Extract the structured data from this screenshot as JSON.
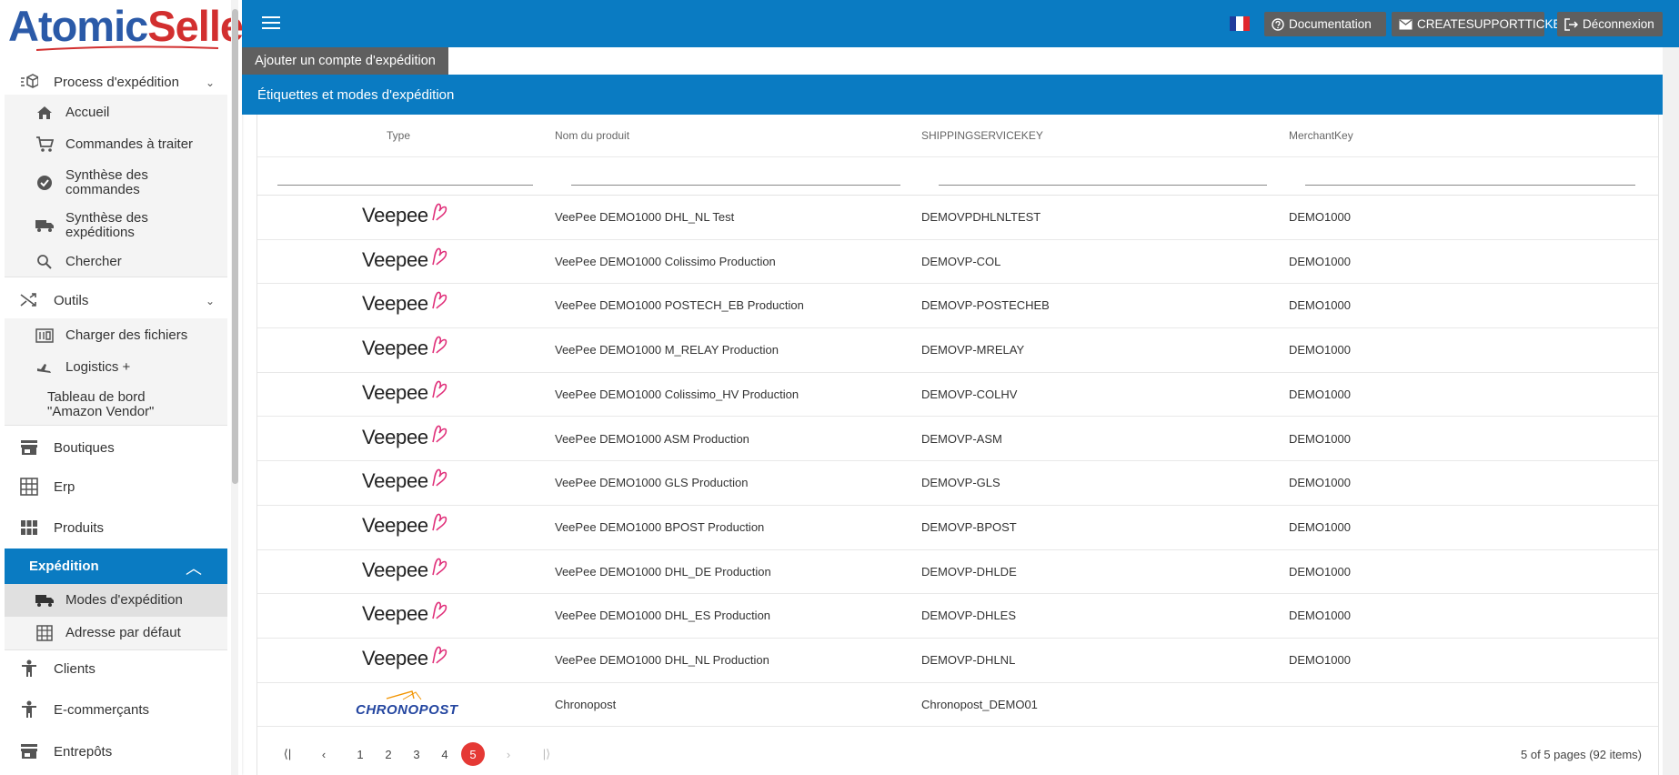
{
  "brand": {
    "part1": "Atomic",
    "part2": "Seller"
  },
  "sidebar": {
    "process": {
      "label": "Process d'expédition"
    },
    "process_items": [
      {
        "label": "Accueil"
      },
      {
        "label": "Commandes à traiter"
      },
      {
        "label": "Synthèse des commandes"
      },
      {
        "label": "Synthèse des expéditions"
      },
      {
        "label": "Chercher"
      }
    ],
    "outils": {
      "label": "Outils"
    },
    "outils_items": [
      {
        "label": "Charger des fichiers"
      },
      {
        "label": "Logistics +"
      },
      {
        "label": "Tableau de bord \"Amazon Vendor\""
      }
    ],
    "boutiques": {
      "label": "Boutiques"
    },
    "erp": {
      "label": "Erp"
    },
    "produits": {
      "label": "Produits"
    },
    "expedition": {
      "label": "Expédition"
    },
    "expedition_items": [
      {
        "label": "Modes d'expédition"
      },
      {
        "label": "Adresse par défaut"
      }
    ],
    "clients": {
      "label": "Clients"
    },
    "ecommercants": {
      "label": "E-commerçants"
    },
    "entrepots": {
      "label": "Entrepôts"
    }
  },
  "topbar": {
    "documentation": "Documentation",
    "support": "CREATESUPPORTTICKET",
    "logout": "Déconnexion"
  },
  "add_account_button": "Ajouter un compte d'expédition",
  "panel_title": "Étiquettes et modes d'expédition",
  "grid": {
    "columns": [
      "Type",
      "Nom du produit",
      "SHIPPINGSERVICEKEY",
      "MerchantKey"
    ],
    "rows": [
      {
        "type": "Veepee",
        "product": "VeePee DEMO1000 DHL_NL Test",
        "key": "DEMOVPDHLNLTEST",
        "merchant": "DEMO1000"
      },
      {
        "type": "Veepee",
        "product": "VeePee DEMO1000 Colissimo Production",
        "key": "DEMOVP-COL",
        "merchant": "DEMO1000"
      },
      {
        "type": "Veepee",
        "product": "VeePee DEMO1000 POSTECH_EB Production",
        "key": "DEMOVP-POSTECHEB",
        "merchant": "DEMO1000"
      },
      {
        "type": "Veepee",
        "product": "VeePee DEMO1000 M_RELAY Production",
        "key": "DEMOVP-MRELAY",
        "merchant": "DEMO1000"
      },
      {
        "type": "Veepee",
        "product": "VeePee DEMO1000 Colissimo_HV Production",
        "key": "DEMOVP-COLHV",
        "merchant": "DEMO1000"
      },
      {
        "type": "Veepee",
        "product": "VeePee DEMO1000 ASM Production",
        "key": "DEMOVP-ASM",
        "merchant": "DEMO1000"
      },
      {
        "type": "Veepee",
        "product": "VeePee DEMO1000 GLS Production",
        "key": "DEMOVP-GLS",
        "merchant": "DEMO1000"
      },
      {
        "type": "Veepee",
        "product": "VeePee DEMO1000 BPOST Production",
        "key": "DEMOVP-BPOST",
        "merchant": "DEMO1000"
      },
      {
        "type": "Veepee",
        "product": "VeePee DEMO1000 DHL_DE Production",
        "key": "DEMOVP-DHLDE",
        "merchant": "DEMO1000"
      },
      {
        "type": "Veepee",
        "product": "VeePee DEMO1000 DHL_ES Production",
        "key": "DEMOVP-DHLES",
        "merchant": "DEMO1000"
      },
      {
        "type": "Veepee",
        "product": "VeePee DEMO1000 DHL_NL Production",
        "key": "DEMOVP-DHLNL",
        "merchant": "DEMO1000"
      },
      {
        "type": "CHRONOPOST",
        "product": "Chronopost",
        "key": "Chronopost_DEMO01",
        "merchant": ""
      }
    ]
  },
  "pager": {
    "pages": [
      "1",
      "2",
      "3",
      "4",
      "5"
    ],
    "current": "5",
    "info": "5 of 5 pages (92 items)"
  },
  "colors": {
    "primary": "#0a7bc2",
    "accent": "#e53935",
    "button_gray": "#5f5f5f",
    "veepee_pink": "#e0307a",
    "chrono_blue": "#2446a0",
    "chrono_orange": "#f29400"
  },
  "icons": {
    "process": "box-process-icon",
    "home": "home-icon",
    "cart": "cart-icon",
    "summary": "gear-badge-icon",
    "shipping_summary": "truck-icon",
    "search": "search-icon",
    "tools": "shuffle-icon",
    "upload": "file-upload-icon",
    "logistics": "plane-icon",
    "store": "store-icon",
    "erp": "grid-icon",
    "products": "apps-icon",
    "truck": "truck-icon",
    "address": "grid-icon",
    "person": "person-icon",
    "warehouse": "warehouse-icon"
  }
}
